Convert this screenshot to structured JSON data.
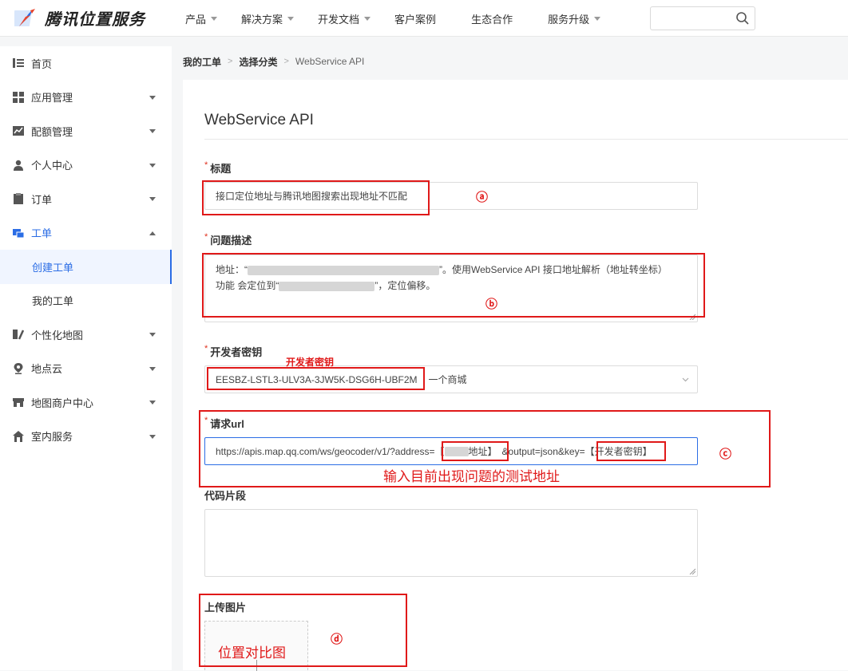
{
  "brand": {
    "name": "腾讯位置服务"
  },
  "nav": {
    "items": [
      {
        "label": "产品",
        "dropdown": true
      },
      {
        "label": "解决方案",
        "dropdown": true
      },
      {
        "label": "开发文档",
        "dropdown": true
      },
      {
        "label": "客户案例",
        "dropdown": false
      },
      {
        "label": "生态合作",
        "dropdown": false
      },
      {
        "label": "服务升级",
        "dropdown": true
      }
    ],
    "search_value": ""
  },
  "sidebar": {
    "items": [
      {
        "label": "首页"
      },
      {
        "label": "应用管理"
      },
      {
        "label": "配额管理"
      },
      {
        "label": "个人中心"
      },
      {
        "label": "订单"
      },
      {
        "label": "工单"
      },
      {
        "label": "创建工单"
      },
      {
        "label": "我的工单"
      },
      {
        "label": "个性化地图"
      },
      {
        "label": "地点云"
      },
      {
        "label": "地图商户中心"
      },
      {
        "label": "室内服务"
      }
    ]
  },
  "breadcrumb": [
    "我的工单",
    "选择分类",
    "WebService API"
  ],
  "form": {
    "title": "WebService API",
    "title_label": "标题",
    "title_value": "接口定位地址与腾讯地图搜索出现地址不匹配",
    "desc_label": "问题描述",
    "desc_line1_a": "地址：“",
    "desc_line1_b": "”。使用WebService API 接口地址解析（地址转坐标）",
    "desc_line2_a": "功能 会定位到“",
    "desc_line2_b": "”，定位偏移。",
    "key_label": "开发者密钥",
    "key_value": "EESBZ-LSTL3-ULV3A-3JW5K-DSG6H-UBF2M",
    "key_app": "一个商城",
    "url_label": "请求url",
    "url_prefix": "https://apis.map.qq.com/ws/geocoder/v1/?address=",
    "url_addr_open": "【",
    "url_addr_close": "地址】",
    "url_middle": "&output=json&key=",
    "url_key": "【开发者密钥】",
    "code_label": "代码片段",
    "upload_label": "上传图片"
  },
  "annotations": {
    "a": "ⓐ",
    "b": "ⓑ",
    "c": "ⓒ",
    "d": "ⓓ",
    "key_note": "开发者密钥",
    "url_note": "输入目前出现问题的测试地址",
    "upload_note": "位置对比图"
  },
  "colors": {
    "accent": "#2b6de5",
    "annotation": "#e01919",
    "required": "#e0301e"
  }
}
